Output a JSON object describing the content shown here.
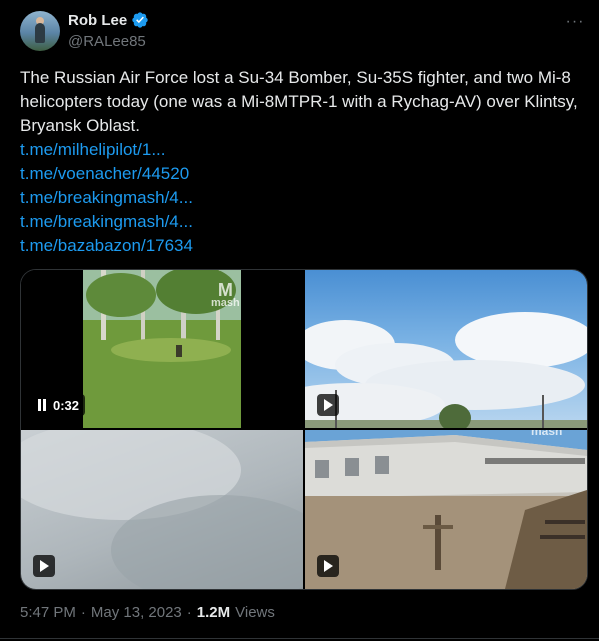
{
  "author": {
    "name": "Rob Lee",
    "handle": "@RALee85"
  },
  "tweet": {
    "text": "The Russian Air Force lost a Su-34 Bomber, Su-35S fighter, and two Mi-8 helicopters today (one was a Mi-8MTPR-1 with a Rychag-AV) over Klintsy, Bryansk Oblast.",
    "links": [
      "t.me/milhelipilot/1...",
      "t.me/voenacher/44520",
      "t.me/breakingmash/4...",
      "t.me/breakingmash/4...",
      "t.me/bazabazon/17634"
    ]
  },
  "media": {
    "video1_duration": "0:32",
    "watermark": "mash"
  },
  "footer": {
    "time": "5:47 PM",
    "dot1": "·",
    "date": "May 13, 2023",
    "dot2": "·",
    "views_count": "1.2M",
    "views_label": "Views"
  },
  "colors": {
    "background": "#000000",
    "text": "#e7e9ea",
    "muted": "#71767b",
    "link": "#1d9bf0",
    "verified": "#1d9bf0"
  }
}
